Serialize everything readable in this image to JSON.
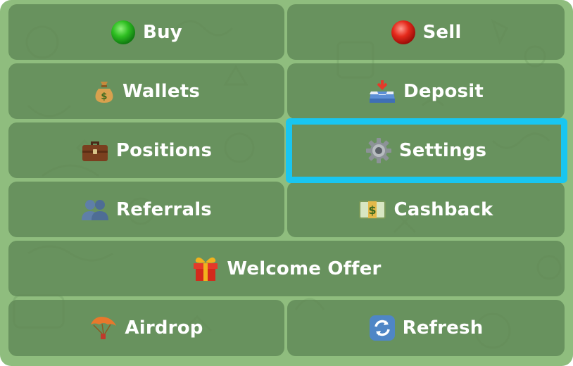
{
  "menu": {
    "buy": {
      "label": "Buy",
      "icon": "green-circle-icon"
    },
    "sell": {
      "label": "Sell",
      "icon": "red-circle-icon"
    },
    "wallets": {
      "label": "Wallets",
      "icon": "money-bag-icon"
    },
    "deposit": {
      "label": "Deposit",
      "icon": "inbox-tray-icon"
    },
    "positions": {
      "label": "Positions",
      "icon": "briefcase-icon"
    },
    "settings": {
      "label": "Settings",
      "icon": "gear-icon"
    },
    "referrals": {
      "label": "Referrals",
      "icon": "people-icon"
    },
    "cashback": {
      "label": "Cashback",
      "icon": "dollar-banknote-icon"
    },
    "welcome_offer": {
      "label": "Welcome Offer",
      "icon": "gift-icon"
    },
    "airdrop": {
      "label": "Airdrop",
      "icon": "parachute-icon"
    },
    "refresh": {
      "label": "Refresh",
      "icon": "refresh-arrows-icon"
    }
  },
  "colors": {
    "background": "#8fbd7e",
    "button": "#5e8554",
    "highlight": "#19c6f0"
  }
}
